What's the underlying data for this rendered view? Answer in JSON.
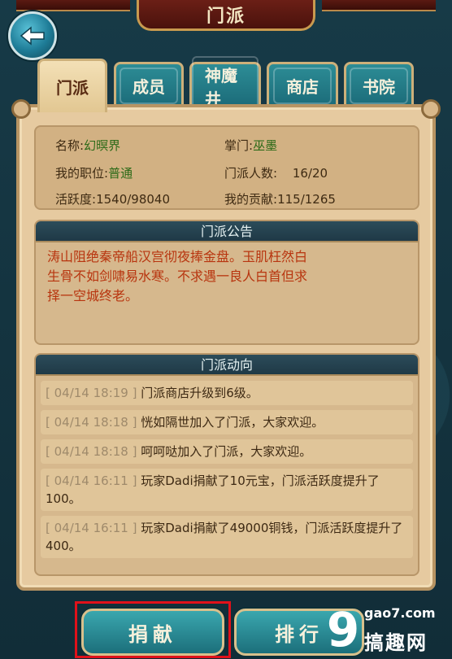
{
  "header": {
    "title": "门派"
  },
  "tabs": [
    {
      "label": "门派",
      "active": true
    },
    {
      "label": "成员",
      "active": false
    },
    {
      "label": "神魔井",
      "active": false
    },
    {
      "label": "商店",
      "active": false
    },
    {
      "label": "书院",
      "active": false
    }
  ],
  "info": {
    "name_label": "名称:",
    "name_value": "幻暝界",
    "leader_label": "掌门:",
    "leader_value": "巫墨",
    "position_label": "我的职位:",
    "position_value": "普通",
    "members_label": "门派人数:",
    "members_value": "16/20",
    "activity_label": "活跃度:",
    "activity_value": "1540/98040",
    "contribution_label": "我的贡献:",
    "contribution_value": "115/1265"
  },
  "notice": {
    "title": "门派公告",
    "lines": [
      "涛山阻绝秦帝船汉宫彻夜捧金盘。玉肌枉然白",
      "生骨不如剑啸易水寒。不求遇一良人白首但求",
      "择一空城终老。"
    ]
  },
  "feed": {
    "title": "门派动向",
    "items": [
      {
        "time": "[ 04/14  18:19 ]",
        "text": "门派商店升级到6级。"
      },
      {
        "time": "[ 04/14  18:18 ]",
        "text": "恍如隔世加入了门派，大家欢迎。"
      },
      {
        "time": "[ 04/14  18:18 ]",
        "text": "呵呵哒加入了门派，大家欢迎。"
      },
      {
        "time": "[ 04/14  16:11 ]",
        "text": "玩家Dadi捐献了10元宝，门派活跃度提升了100。"
      },
      {
        "time": "[ 04/14  16:11 ]",
        "text": "玩家Dadi捐献了49000铜钱，门派活跃度提升了400。"
      }
    ]
  },
  "buttons": {
    "donate": "捐献",
    "ranking": "排行"
  },
  "watermark": {
    "logo": "9",
    "url": "gao7.com",
    "name": "搞趣网"
  },
  "colors": {
    "accent_red": "#e0111a",
    "notice_text": "#b8350f",
    "position_green": "#2c6a18"
  }
}
